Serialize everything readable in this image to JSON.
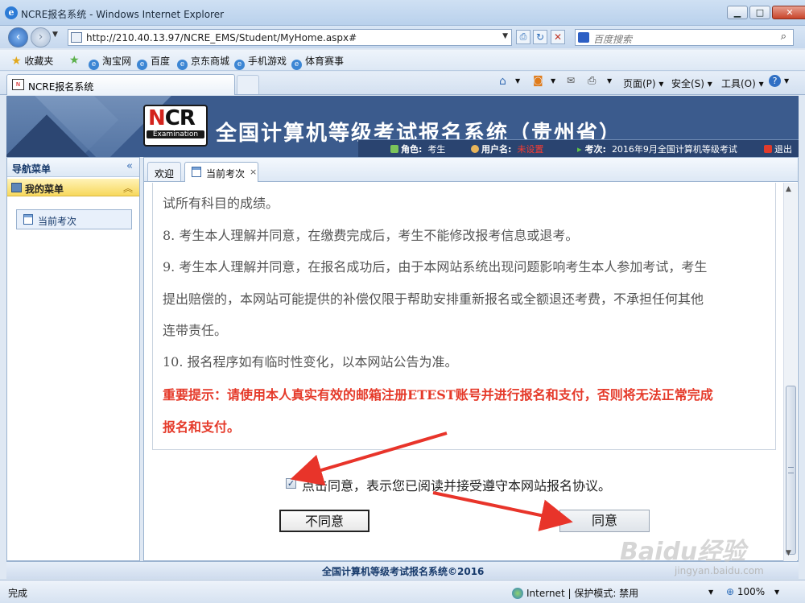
{
  "window": {
    "title": "NCRE报名系统 - Windows Internet Explorer",
    "minimize": "▁",
    "maximize": "□",
    "close": "✕"
  },
  "address_bar": {
    "url": "http://210.40.13.97/NCRE_EMS/Student/MyHome.aspx#",
    "search_placeholder": "百度搜索"
  },
  "favorites": {
    "label": "收藏夹",
    "items": [
      "淘宝网",
      "百度",
      "京东商城",
      "手机游戏",
      "体育赛事"
    ]
  },
  "browser_tab": {
    "label": "NCRE报名系统"
  },
  "command_bar": {
    "page": "页面(P) ▾",
    "safety": "安全(S) ▾",
    "tools": "工具(O) ▾"
  },
  "header": {
    "logo_text": "NCRE",
    "logo_sub": "Examination",
    "site_title": "全国计算机等级考试报名系统（贵州省）",
    "role_label": "角色:",
    "role_value": "考生",
    "user_label": "用户名:",
    "user_value": "未设置",
    "exam_label": "考次:",
    "exam_value": "2016年9月全国计算机等级考试",
    "logout": "退出"
  },
  "sidebar": {
    "title": "导航菜单",
    "collapse_icon": "«",
    "my_menu": "我的菜单",
    "my_menu_icon": "︽",
    "items": [
      {
        "label": "当前考次"
      }
    ]
  },
  "main_tabs": [
    {
      "label": "欢迎"
    },
    {
      "label": "当前考次",
      "close": "×"
    }
  ],
  "agreement_lines": [
    "试所有科目的成绩。",
    "8. 考生本人理解并同意，在缴费完成后，考生不能修改报考信息或退考。",
    "9. 考生本人理解并同意，在报名成功后，由于本网站系统出现问题影响考生本人参加考试，考生",
    "提出赔偿的，本网站可能提供的补偿仅限于帮助安排重新报名或全额退还考费，不承担任何其他",
    "连带责任。",
    "10. 报名程序如有临时性变化，以本网站公告为准。"
  ],
  "important_notice": [
    "重要提示：请使用本人真实有效的邮箱注册ETEST账号并进行报名和支付，否则将无法正常完成",
    "报名和支付。"
  ],
  "agreement_checkbox": {
    "checked": true,
    "label": "点击同意，表示您已阅读并接受遵守本网站报名协议。"
  },
  "buttons": {
    "disagree": "不同意",
    "agree": "同意"
  },
  "footer": {
    "text": "全国计算机等级考试报名系统©2016"
  },
  "status_bar": {
    "left": "完成",
    "zone": "Internet | 保护模式: 禁用",
    "zoom": "100%"
  },
  "watermark": {
    "text": "Baidu经验",
    "url": "jingyan.baidu.com"
  },
  "colors": {
    "header_bg": "#3b5b8d",
    "notice_red": "#e53a2a",
    "arrow_red": "#e8342a"
  }
}
